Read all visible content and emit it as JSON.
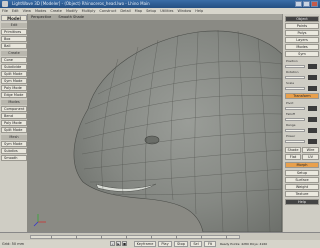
{
  "title": {
    "text": "LightWave 3D [Modeler] - (Object) Rhinoceros_head.lwo - Lhino Main"
  },
  "menus": [
    "File",
    "Edit",
    "View",
    "Modes",
    "Create",
    "Modify",
    "Multiply",
    "Construct",
    "Detail",
    "Map",
    "Setup",
    "Utilities",
    "Window",
    "Help"
  ],
  "left": {
    "tab": "Model",
    "groups": {
      "edit": "Edit",
      "create": "Create",
      "modes": "Modes",
      "mesh": "Mesh"
    },
    "buttons": [
      "Primitives",
      "Box",
      "Ball",
      "Cone",
      "Subdivide",
      "Split Mode",
      "Sym Mode",
      "Poly Mode",
      "Edge Mode",
      "Component",
      "Bend",
      "Poly Mode",
      "Split Mode",
      "Sym Mode",
      "Subdivs",
      "Smooth"
    ]
  },
  "viewport": {
    "label": "Perspective",
    "mode": "Smooth Shade"
  },
  "right": {
    "buttons": {
      "object": "Object",
      "points": "Points",
      "polys": "Polys",
      "layers": "Layers",
      "modes": "Modes",
      "sym": "Sym",
      "transform": "Transform",
      "shade": "Shade",
      "wire": "Wire",
      "flat": "Flat",
      "uv": "UV",
      "morph": "Morph",
      "setup": "Setup",
      "surface": "Surface",
      "weight": "Weight",
      "texture": "Texture",
      "help": "Help"
    },
    "labels": [
      "Position",
      "Rotation",
      "Scale",
      "Pivot",
      "Falloff",
      "Range",
      "Power"
    ]
  },
  "status": {
    "text": "Grid: 50 mm",
    "buttons": {
      "keyframe": "Keyframe",
      "play": "Play",
      "stop": "Stop",
      "sel": "Sel",
      "fit": "Fit"
    },
    "info": "Ready  Points: 4280  Polys: 4160"
  },
  "colors": {
    "viewport_bg": "#8a8a84",
    "mesh_fill": "#878a85",
    "mesh_wire": "#4a4c48",
    "accent_orange": "#e8a04c"
  },
  "icons": [
    "app-icon",
    "minimize-icon",
    "maximize-icon",
    "close-icon",
    "axis-icon"
  ]
}
